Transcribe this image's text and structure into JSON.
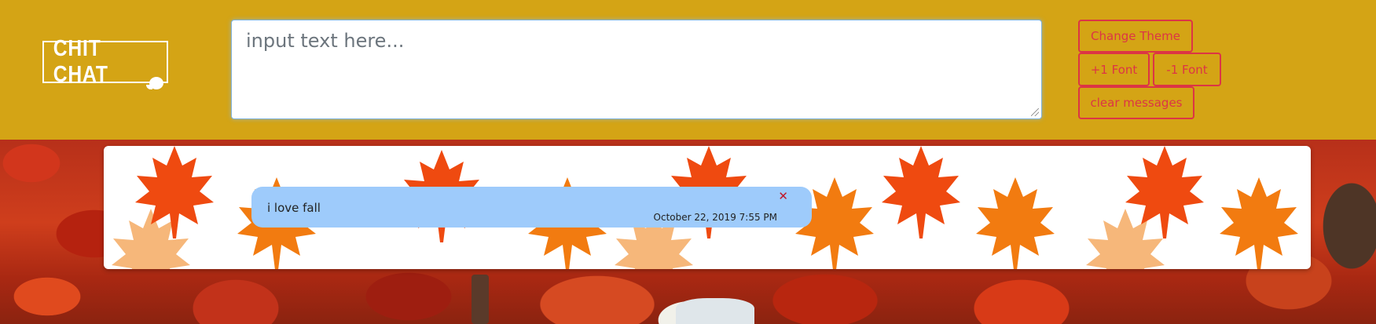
{
  "app": {
    "logo_text": "CHIT CHAT"
  },
  "composer": {
    "placeholder": "input text here..."
  },
  "controls": {
    "change_theme": "Change Theme",
    "font_increase": "+1 Font",
    "font_decrease": "-1 Font",
    "clear_messages": "clear messages"
  },
  "messages": [
    {
      "text": "i love fall",
      "timestamp": "October 22, 2019 7:55 PM",
      "delete_icon": "close-icon"
    }
  ],
  "theme": {
    "header_color": "#d4a415",
    "button_color": "#dc3545",
    "bubble_color": "#9ecbfb",
    "name": "fall"
  }
}
